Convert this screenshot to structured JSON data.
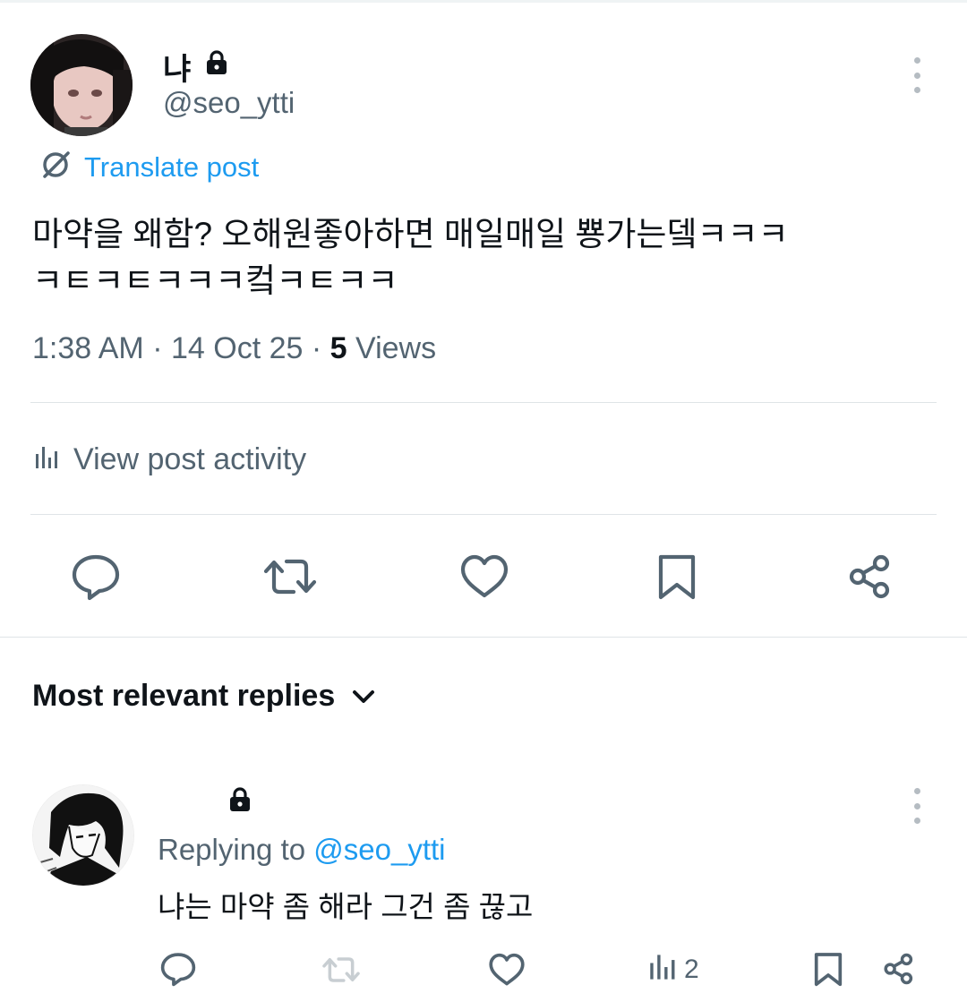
{
  "post": {
    "author_name": "냐",
    "handle": "@seo_ytti",
    "translate_label": "Translate post",
    "text_line1": "마약을 왜함? 오해원좋아하면 매일매일 뿅가는뎈ㅋㅋㅋ",
    "text_line2": "ㅋㅌㅋㅌㅋㅋㅋ컼ㅋㅌㅋㅋ",
    "time": "1:38 AM",
    "date": "14 Oct 25",
    "views_count": "5",
    "views_label": "Views",
    "activity_label": "View post activity"
  },
  "replies_section": {
    "title": "Most relevant replies"
  },
  "reply": {
    "replying_prefix": "Replying to",
    "replying_handle": "@seo_ytti",
    "text": "냐는 마약 좀 해라 그건 좀 끊고",
    "views_count": "2"
  },
  "colors": {
    "accent": "#1d9bf0",
    "secondary_text": "#536471",
    "icon": "#536471",
    "divider": "#dfe4e7"
  },
  "icons": [
    "lock-icon",
    "more-icon",
    "translate-icon",
    "analytics-icon",
    "reply-icon",
    "repost-icon",
    "like-icon",
    "bookmark-icon",
    "share-icon",
    "chevron-down-icon"
  ]
}
